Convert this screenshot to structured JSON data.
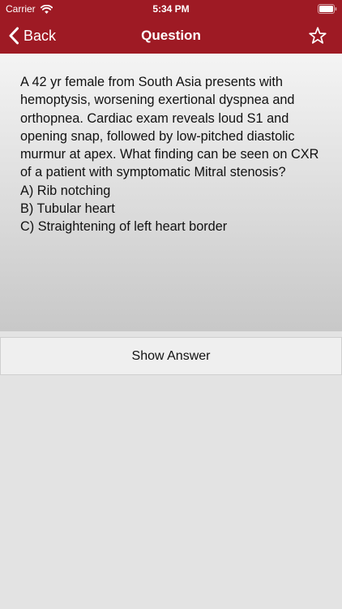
{
  "status_bar": {
    "carrier": "Carrier",
    "time": "5:34 PM",
    "icons": [
      "wifi-icon",
      "battery-icon"
    ]
  },
  "nav": {
    "back_label": "Back",
    "title": "Question",
    "icons": [
      "chevron-left-icon",
      "star-outline-icon"
    ]
  },
  "question": {
    "text": "A 42 yr female from South Asia presents with hemoptysis, worsening exertional dyspnea and orthopnea. Cardiac exam reveals loud S1 and opening snap, followed by low-pitched diastolic murmur at apex. What finding can be seen on CXR of a patient with symptomatic Mitral stenosis?\nA) Rib notching\nB) Tubular heart\nC) Straightening of left heart border"
  },
  "actions": {
    "show_answer_label": "Show Answer"
  },
  "colors": {
    "brand": "#9e1a24",
    "background": "#e3e3e3"
  }
}
